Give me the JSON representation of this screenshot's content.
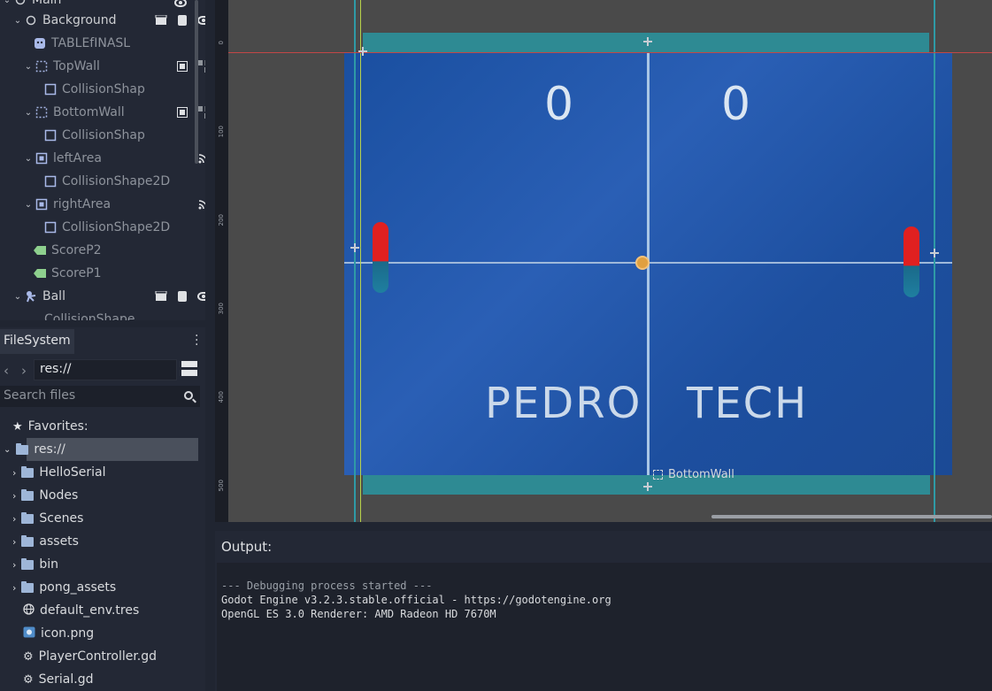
{
  "scene_tree": {
    "rows": [
      {
        "label": "Main",
        "depth": 0
      },
      {
        "label": "Background",
        "depth": 1
      },
      {
        "label": "TABLEfINASL",
        "depth": 2
      },
      {
        "label": "TopWall",
        "depth": 2
      },
      {
        "label": "CollisionShap",
        "depth": 3
      },
      {
        "label": "BottomWall",
        "depth": 2
      },
      {
        "label": "CollisionShap",
        "depth": 3
      },
      {
        "label": "leftArea",
        "depth": 2
      },
      {
        "label": "CollisionShape2D",
        "depth": 3
      },
      {
        "label": "rightArea",
        "depth": 2
      },
      {
        "label": "CollisionShape2D",
        "depth": 3
      },
      {
        "label": "ScoreP2",
        "depth": 2
      },
      {
        "label": "ScoreP1",
        "depth": 2
      },
      {
        "label": "Ball",
        "depth": 1
      },
      {
        "label": "CollisionShape",
        "depth": 2
      }
    ]
  },
  "filesystem": {
    "tab_label": "FileSystem",
    "path": "res://",
    "search_placeholder": "Search files",
    "favorites_label": "Favorites:",
    "root_label": "res://",
    "items": [
      {
        "label": "HelloSerial",
        "type": "folder"
      },
      {
        "label": "Nodes",
        "type": "folder"
      },
      {
        "label": "Scenes",
        "type": "folder"
      },
      {
        "label": "assets",
        "type": "folder"
      },
      {
        "label": "bin",
        "type": "folder"
      },
      {
        "label": "pong_assets",
        "type": "folder"
      },
      {
        "label": "default_env.tres",
        "type": "resource"
      },
      {
        "label": "icon.png",
        "type": "image"
      },
      {
        "label": "PlayerController.gd",
        "type": "script"
      },
      {
        "label": "Serial.gd",
        "type": "script"
      }
    ]
  },
  "viewport": {
    "ruler_ticks": [
      "0",
      "100",
      "200",
      "300",
      "400",
      "500"
    ],
    "score_left": "0",
    "score_right": "0",
    "brand_left": "PEDRO",
    "brand_right": "TECH",
    "selected_node_label": "BottomWall"
  },
  "output": {
    "title": "Output:",
    "lines": [
      "--- Debugging process started ---",
      "Godot Engine v3.2.3.stable.official - https://godotengine.org",
      "OpenGL ES 3.0 Renderer: AMD Radeon HD 7670M"
    ]
  },
  "colors": {
    "accent_selection": "#4a505c",
    "court_blue": "#1d4f9f",
    "wall_teal": "#2e8a93",
    "paddle_red": "#e02020"
  }
}
